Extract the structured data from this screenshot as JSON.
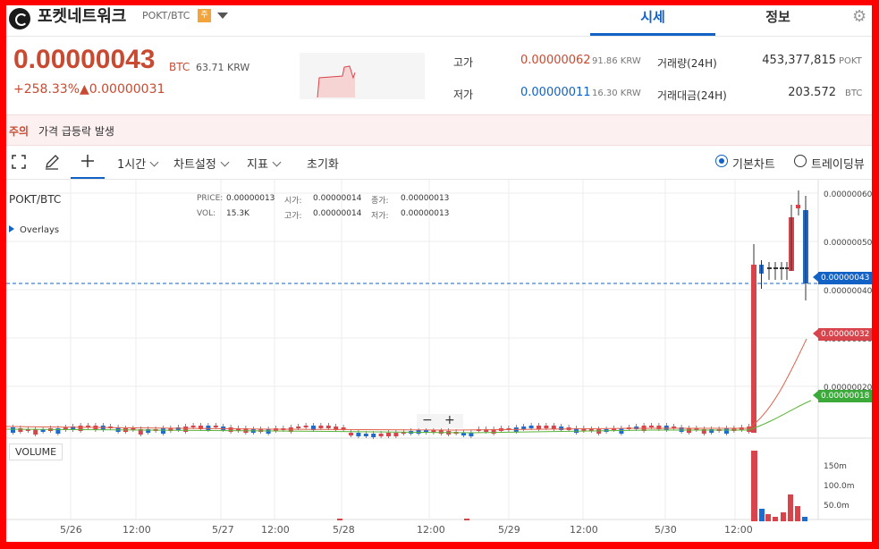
{
  "header": {
    "coin_name": "포켓네트워크",
    "pair": "POKT/BTC",
    "warning_badge": "주",
    "tabs": [
      {
        "label": "시세",
        "active": true
      },
      {
        "label": "정보",
        "active": false
      }
    ]
  },
  "price": {
    "current": "0.00000043",
    "unit": "BTC",
    "krw": "63.71 KRW",
    "change_pct": "+258.33%",
    "change_amt": "▲0.00000031"
  },
  "stats": {
    "high_label": "고가",
    "high_value": "0.00000062",
    "high_krw": "91.86 KRW",
    "low_label": "저가",
    "low_value": "0.00000011",
    "low_krw": "16.30 KRW",
    "volume_label": "거래량(24H)",
    "volume_value": "453,377,815",
    "volume_unit": "POKT",
    "amount_label": "거래대금(24H)",
    "amount_value": "203.572",
    "amount_unit": "BTC"
  },
  "caution": {
    "tag": "주의",
    "message": "가격 급등락 발생"
  },
  "toolbar": {
    "interval": "1시간",
    "chart_settings": "차트설정",
    "indicators": "지표",
    "reset": "초기화",
    "view_basic": "기본차트",
    "view_tradingview": "트레이딩뷰"
  },
  "chart": {
    "symbol": "POKT/BTC",
    "overlays": "Overlays",
    "volume_label": "VOLUME",
    "info": {
      "price_label": "PRICE:",
      "price": "0.00000013",
      "vol_label": "VOL:",
      "vol": "15.3K",
      "open_label": "시가:",
      "open": "0.00000014",
      "high_label": "고가:",
      "high": "0.00000014",
      "close_label": "종가:",
      "close": "0.00000013",
      "low_label": "저가:",
      "low": "0.00000013"
    },
    "y_ticks": [
      "0.00000060",
      "0.00000050",
      "0.00000040",
      "0.00000030",
      "0.00000020"
    ],
    "current_tag": "0.00000043",
    "ma1_tag": "0.00000032",
    "ma2_tag": "0.00000018",
    "vol_ticks": [
      "150m",
      "100.0m",
      "50.0m"
    ],
    "x_ticks": [
      "5/26",
      "12:00",
      "5/27",
      "12:00",
      "5/28",
      "12:00",
      "5/29",
      "12:00",
      "5/30",
      "12:00"
    ],
    "zoom_minus": "−",
    "zoom_plus": "+",
    "colors": {
      "up": "#d8444b",
      "down": "#1e6bd0",
      "ma1": "#e0604a",
      "ma2": "#5ab43a",
      "current": "#1261c4"
    }
  }
}
